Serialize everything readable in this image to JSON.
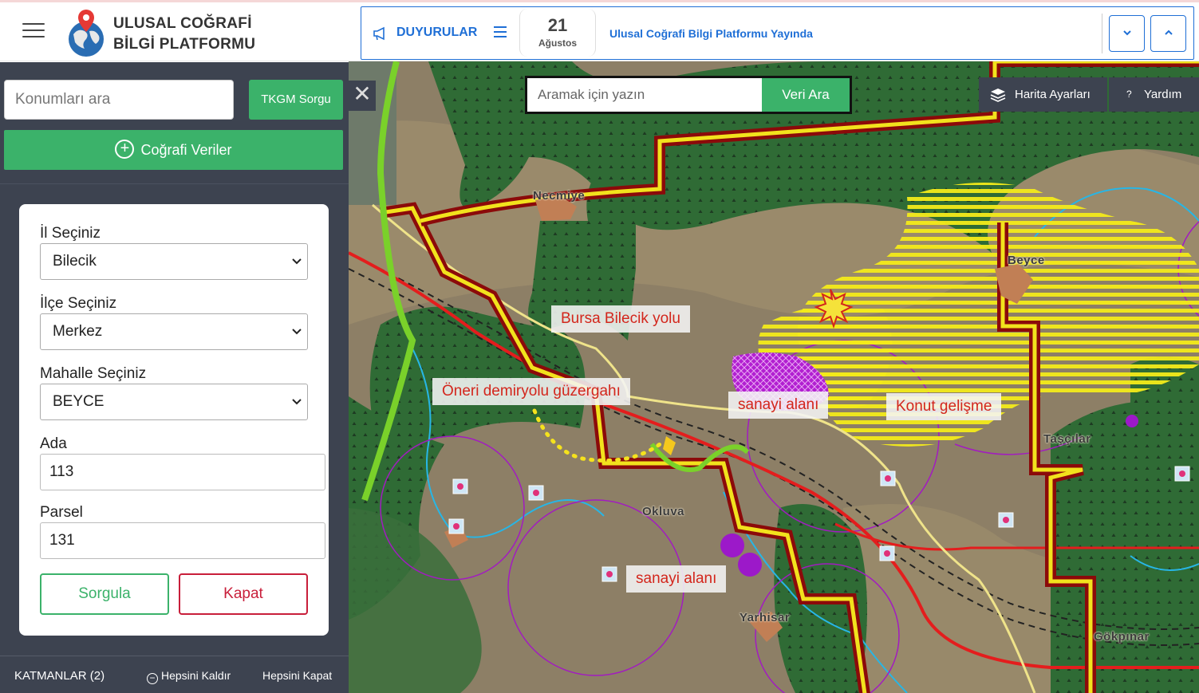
{
  "header": {
    "brand_line1": "ULUSAL COĞRAFİ",
    "brand_line2": "BİLGİ PLATFORMU",
    "menu_icon": "hamburger-icon",
    "logo_icon": "globe-pin-logo"
  },
  "announcements": {
    "title": "DUYURULAR",
    "icon": "megaphone-icon",
    "list_icon": "list-icon",
    "date_day": "21",
    "date_month": "Ağustos",
    "text": "Ulusal Coğrafi Bilgi Platformu Yayında",
    "accent_color": "#1f6fd6"
  },
  "sidebar": {
    "location_search_placeholder": "Konumları ara",
    "tkgm_button": "TKGM Sorgu",
    "geo_data_button": "Coğrafi Veriler",
    "form": {
      "province_label": "İl Seçiniz",
      "province_value": "Bilecik",
      "district_label": "İlçe Seçiniz",
      "district_value": "Merkez",
      "neighborhood_label": "Mahalle Seçiniz",
      "neighborhood_value": "BEYCE",
      "block_label": "Ada",
      "block_value": "113",
      "parcel_label": "Parsel",
      "parcel_value": "131",
      "query_button": "Sorgula",
      "close_button": "Kapat"
    },
    "layers": {
      "title": "KATMANLAR (2)",
      "remove_all": "Hepsini Kaldır",
      "close_all": "Hepsini Kapat"
    },
    "accent_color": "#3bb26a",
    "danger_color": "#c81e3a"
  },
  "map": {
    "search_placeholder": "Aramak için yazın",
    "search_button": "Veri Ara",
    "settings_button": "Harita Ayarları",
    "help_button": "Yardım",
    "help_prefix": "?",
    "close_symbol": "✕",
    "labels": {
      "road": "Bursa Bilecik yolu",
      "railway": "Öneri demiryolu güzergahı",
      "industry1": "sanayi alanı",
      "housing": "Konut gelişme",
      "industry2": "sanayi alanı"
    },
    "places": {
      "necmiye": "Necmiye",
      "beyce": "Beyce",
      "tascilar": "Taşçılar",
      "okluva": "Okluva",
      "yarhisar": "Yarhisar",
      "gokpinar": "Gökpınar"
    }
  }
}
